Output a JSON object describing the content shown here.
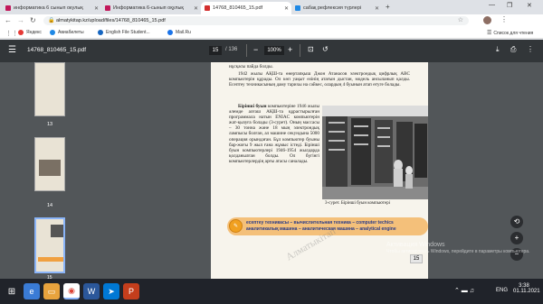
{
  "tabs": [
    {
      "label": "информатика 6 сынып окулық",
      "color": "#c2185b"
    },
    {
      "label": "Информатика 6-сынып оқулық",
      "color": "#c2185b"
    },
    {
      "label": "14768_810465_15.pdf",
      "color": "#d32f2f"
    },
    {
      "label": "сабақ рефлексия түрлері",
      "color": "#1e88e5"
    }
  ],
  "address": {
    "url": "almatykitap.kz/upload/files/14768_810465_15.pdf"
  },
  "bookmarks": {
    "items": [
      "Яндекс",
      "Авиабилеты",
      "English File Student...",
      "Mail.Ru"
    ],
    "reading_list": "Список для чтения"
  },
  "pdf": {
    "filename": "14768_810465_15.pdf",
    "page_current": "15",
    "page_total": "136",
    "zoom": "100%"
  },
  "thumbnails": [
    "13",
    "14",
    "15"
  ],
  "content": {
    "top_line": "нұсқасы пайда болды.",
    "para1": "1942 жылы АҚШ-та өнертапқыш Джон Атанасов электрондық цифрлық АВС компьютерін құрады. Ол көп уақыт өзінің атағын дыстан, модель ансыланып қалды. Есептеу техникасының даму тарихы на сәйкес, олардың 4 буынын атап өтуге болады.",
    "para2_lead": "Бірінші буын",
    "para2": "компьютеріне 1946 жылы әлемде алғаш АҚШ-та құрастырылған программала натын ENIAC компьютерін жат-қызуға болады (3-сурет). Оның массасы – 30 тоннa және 18 мың электрондық лампысы болған, ал машине секундына 5000 операция орындаған. Бұл компьютер буыны бар-жоғы 9 жыл ғана жұмыс істеді. Бірінші буын компьютерлері 1946-1954 жылдарда қолданылған болды. Ол бүгінгі компьютерлердің арғы атасы саналады.",
    "caption": "3-сурет. Бірінші буын компьютері",
    "glossary": "есептеу техникасы – вычислительная техника – computer techics\nаналитикалық машина – аналитическая машина – analytical engine",
    "page_number": "15",
    "watermark": "Алматыкітап"
  },
  "windows_activation": {
    "title": "Активация Windows",
    "text": "Чтобы активировать Windows, перейдите в параметры компьютера."
  },
  "taskbar": {
    "language": "ENG",
    "time": "3:38",
    "date": "01.11.2021"
  }
}
